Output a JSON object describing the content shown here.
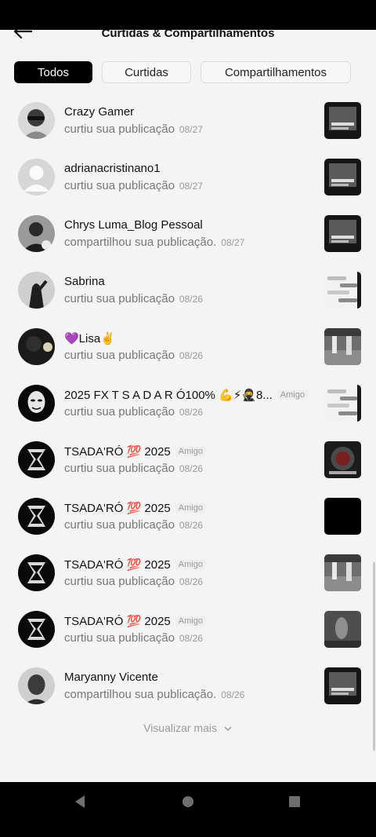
{
  "header": {
    "title": "Curtidas & Compartilhamentos",
    "back_icon": "arrow-left-icon"
  },
  "filters": [
    {
      "label": "Todos",
      "active": true
    },
    {
      "label": "Curtidas",
      "active": false
    },
    {
      "label": "Compartilhamentos",
      "active": false
    }
  ],
  "items": [
    {
      "name": "Crazy Gamer",
      "badge": "",
      "action": "curtiu sua publicação",
      "date": "08/27"
    },
    {
      "name": "adrianacristinano1",
      "badge": "",
      "action": "curtiu sua publicação",
      "date": "08/27"
    },
    {
      "name": "Chrys Luma_Blog Pessoal",
      "badge": "",
      "action": "compartilhou sua publicação.",
      "date": "08/27"
    },
    {
      "name": "Sabrina",
      "badge": "",
      "action": "curtiu sua publicação",
      "date": "08/26"
    },
    {
      "name": "💜Lisa✌️",
      "badge": "",
      "action": "curtiu sua publicação",
      "date": "08/26"
    },
    {
      "name": "2025 FX T S A D A R Ó100% 💪⚡🥷8...",
      "badge": "Amigo",
      "action": "curtiu sua publicação",
      "date": "08/26"
    },
    {
      "name": "TSADA'RÓ 💯 2025",
      "badge": "Amigo",
      "action": "curtiu sua publicação",
      "date": "08/26"
    },
    {
      "name": "TSADA'RÓ 💯 2025",
      "badge": "Amigo",
      "action": "curtiu sua publicação",
      "date": "08/26"
    },
    {
      "name": "TSADA'RÓ 💯 2025",
      "badge": "Amigo",
      "action": "curtiu sua publicação",
      "date": "08/26"
    },
    {
      "name": "TSADA'RÓ 💯 2025",
      "badge": "Amigo",
      "action": "curtiu sua publicação",
      "date": "08/26"
    },
    {
      "name": "Maryanny Vicente",
      "badge": "",
      "action": "compartilhou sua publicação.",
      "date": "08/26"
    }
  ],
  "more": {
    "label": "Visualizar mais",
    "icon": "chevron-down-icon"
  },
  "navbar": {
    "back_icon": "nav-back-icon",
    "home_icon": "nav-home-icon",
    "recents_icon": "nav-recents-icon"
  }
}
